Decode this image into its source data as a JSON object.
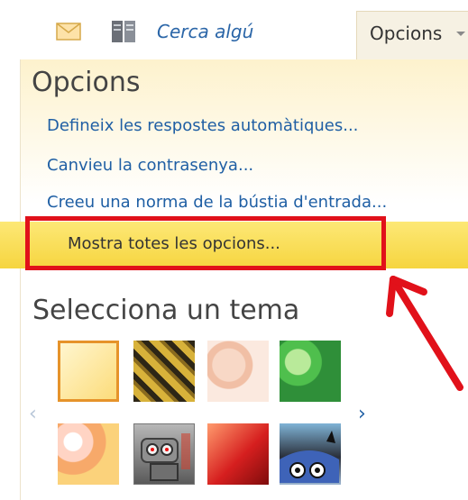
{
  "toolbar": {
    "search_label": "Cerca algú",
    "options_tab_label": "Opcions"
  },
  "panel": {
    "title": "Opcions",
    "links": [
      "Defineix les respostes automàtiques...",
      "Canvieu la contrasenya...",
      "Creeu una norma de la bústia d'entrada..."
    ],
    "highlighted_link": "Mostra totes les opcions..."
  },
  "themes": {
    "title": "Selecciona un tema",
    "items": [
      "theme-light-yellow",
      "theme-tiger",
      "theme-peach",
      "theme-green-leaves",
      "theme-sunset",
      "theme-robot",
      "theme-red-leaves",
      "theme-monster"
    ]
  },
  "colors": {
    "accent": "#1f5fa4",
    "highlight": "#f6d53f",
    "annotation": "#e1111a"
  }
}
